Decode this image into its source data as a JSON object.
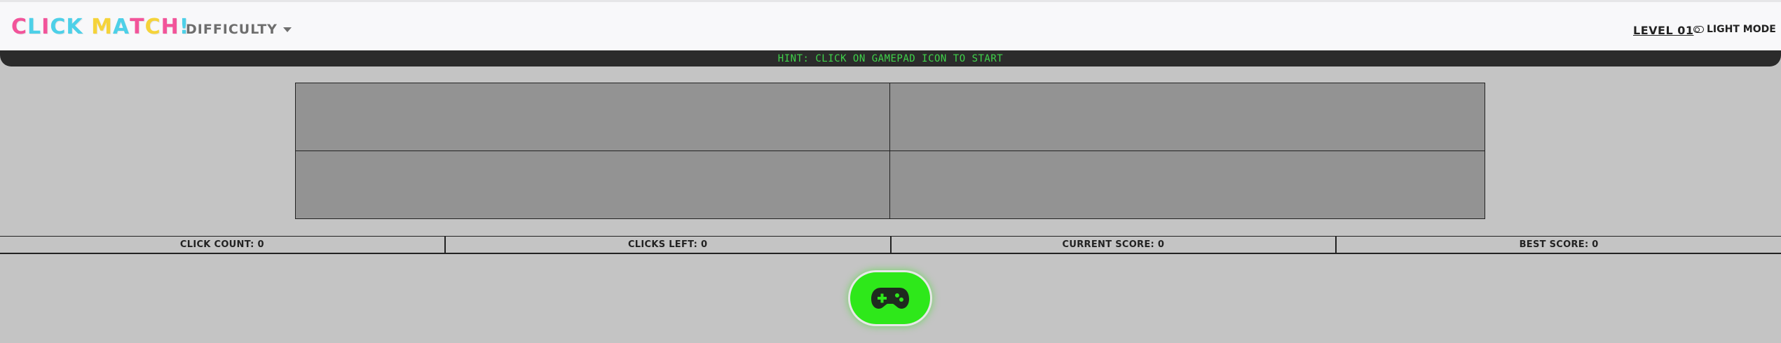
{
  "header": {
    "logo_letters": [
      {
        "char": "C",
        "color": "#f2549a"
      },
      {
        "char": "L",
        "color": "#4dd0e8"
      },
      {
        "char": "I",
        "color": "#f2549a"
      },
      {
        "char": "C",
        "color": "#4dd0e8"
      },
      {
        "char": "K",
        "color": "#4dd0e8"
      },
      {
        "char": " ",
        "color": "#000000"
      },
      {
        "char": "M",
        "color": "#f5d33a"
      },
      {
        "char": "A",
        "color": "#4dd0e8"
      },
      {
        "char": "T",
        "color": "#f2549a"
      },
      {
        "char": "C",
        "color": "#f5d33a"
      },
      {
        "char": "H",
        "color": "#f2549a"
      },
      {
        "char": "!",
        "color": "#4dd0e8"
      }
    ],
    "difficulty_label": "DIFFICULTY",
    "level_label": "LEVEL 01",
    "theme_toggle_label": "LIGHT MODE"
  },
  "hint": "HINT: CLICK ON GAMEPAD ICON TO START",
  "board": {
    "rows": 2,
    "cols": 2,
    "tile_color": "#939393"
  },
  "stats": [
    {
      "label": "CLICK COUNT: 0"
    },
    {
      "label": "CLICKS LEFT: 0"
    },
    {
      "label": "CURRENT SCORE: 0"
    },
    {
      "label": "BEST SCORE: 0"
    }
  ],
  "start_button": {
    "icon": "gamepad-icon",
    "color": "#2ee81a"
  },
  "colors": {
    "background": "#c4c4c4",
    "hint_bar": "#2b2b2b",
    "hint_text": "#3fd24a"
  }
}
